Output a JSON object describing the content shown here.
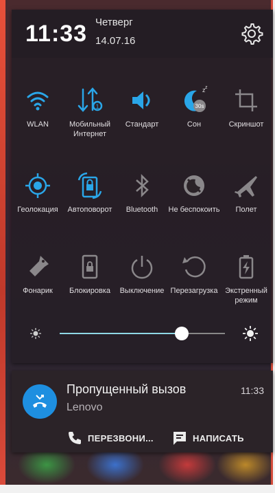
{
  "header": {
    "time": "11:33",
    "day": "Четверг",
    "date": "14.07.16",
    "settings_icon": "gear-icon"
  },
  "tiles": [
    {
      "label": "WLAN",
      "icon": "wifi-icon",
      "active": true
    },
    {
      "label": "Мобильный Интернет",
      "icon": "mobile-data-icon",
      "active": true
    },
    {
      "label": "Стандарт",
      "icon": "sound-icon",
      "active": true
    },
    {
      "label": "Сон",
      "icon": "sleep-timer-icon",
      "active": true,
      "badge": "30s"
    },
    {
      "label": "Скриншот",
      "icon": "screenshot-crop-icon",
      "active": false
    },
    {
      "label": "Геолокация",
      "icon": "location-icon",
      "active": true
    },
    {
      "label": "Автоповорот",
      "icon": "auto-rotate-icon",
      "active": true
    },
    {
      "label": "Bluetooth",
      "icon": "bluetooth-icon",
      "active": false
    },
    {
      "label": "Не беспокоить",
      "icon": "do-not-disturb-icon",
      "active": false
    },
    {
      "label": "Полет",
      "icon": "airplane-icon",
      "active": false
    },
    {
      "label": "Фонарик",
      "icon": "flashlight-icon",
      "active": false
    },
    {
      "label": "Блокировка",
      "icon": "lock-icon",
      "active": false
    },
    {
      "label": "Выключение",
      "icon": "power-icon",
      "active": false
    },
    {
      "label": "Перезагрузка",
      "icon": "restart-icon",
      "active": false
    },
    {
      "label": "Экстренный режим",
      "icon": "battery-saver-icon",
      "active": false
    }
  ],
  "brightness": {
    "level": 0.74
  },
  "notification": {
    "title": "Пропущенный вызов",
    "subtitle": "Lenovo",
    "time": "11:33",
    "icon": "missed-call-icon",
    "actions": [
      {
        "label": "ПЕРЕЗВОНИ...",
        "icon": "phone-icon"
      },
      {
        "label": "НАПИСАТЬ",
        "icon": "message-icon"
      }
    ]
  },
  "colors": {
    "accent": "#2aa6e8",
    "inactive": "#8a878a",
    "avatar": "#1e8fe0"
  }
}
